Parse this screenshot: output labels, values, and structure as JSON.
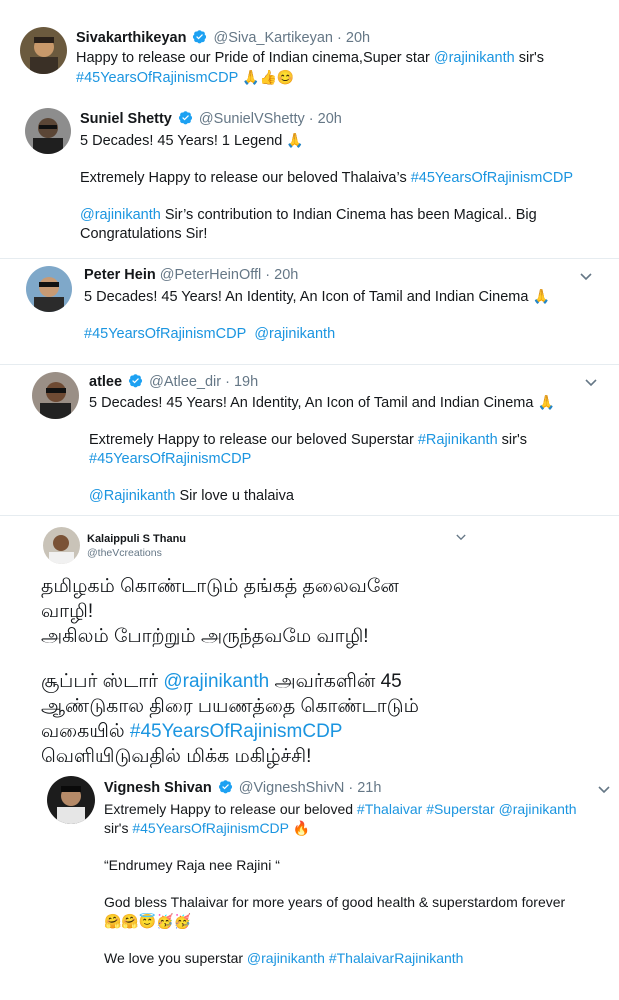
{
  "tweets": {
    "t1": {
      "name": "Sivakarthikeyan",
      "handle": "@Siva_Kartikeyan",
      "dot": "·",
      "time": "20h",
      "text_a": "Happy to release our Pride of Indian cinema,Super star ",
      "mention": "@rajinikanth",
      "text_b": " sir's",
      "hashtag": "#45YearsOfRajinismCDP",
      "emojis": "🙏👍😊"
    },
    "t2": {
      "name": "Suniel Shetty",
      "handle": "@SunielVShetty",
      "dot": "·",
      "time": "20h",
      "line1": "5 Decades! 45 Years! 1 Legend",
      "line1_emoji": "🙏",
      "line2_text": "Extremely Happy to release our beloved Thalaiva’s ",
      "line2_hashtag": "#45YearsOfRajinismCDP",
      "line3_mention": "@rajinikanth",
      "line3_text": " Sir’s contribution to Indian Cinema has been Magical.. Big Congratulations Sir!"
    },
    "t3": {
      "name": "Peter Hein",
      "handle": "@PeterHeinOffl",
      "dot": "·",
      "time": "20h",
      "line1": "5 Decades! 45 Years! An Identity, An Icon of Tamil and Indian Cinema",
      "line1_emoji": "🙏",
      "hashtag": "#45YearsOfRajinismCDP",
      "mention": "@rajinikanth"
    },
    "t4": {
      "name": "atlee",
      "handle": "@Atlee_dir",
      "dot": "·",
      "time": "19h",
      "line1": "5 Decades! 45 Years! An Identity, An Icon of Tamil and Indian Cinema",
      "line1_emoji": "🙏",
      "line2_text": "Extremely Happy to release our beloved Superstar ",
      "line2_hashtag": "#Rajinikanth",
      "line2_tail": " sir's",
      "line3_hashtag": "#45YearsOfRajinismCDP",
      "line4_mention": "@Rajinikanth",
      "line4_text": " Sir love u thalaiva"
    },
    "t5": {
      "name": "Kalaippuli S Thanu",
      "handle": "@theVcreations",
      "l1": "தமிழகம் கொண்டாடும் தங்கத் தலைவனே",
      "l2": "வாழி!",
      "l3": "அகிலம் போற்றும் அருந்தவமே வாழி!",
      "l4a": "சூப்பர் ஸ்டார் ",
      "l4_mention": "@rajinikanth",
      "l4b": " அவர்களின் 45",
      "l5": "ஆண்டுகால திரை பயணத்தை கொண்டாடும்",
      "l6a": "வகையில் ",
      "l6_hashtag": "#45YearsOfRajinismCDP",
      "l7": "வெளியிடுவதில் மிக்க மகிழ்ச்சி!"
    },
    "t6": {
      "name": "Vignesh Shivan",
      "handle": "@VigneshShivN",
      "dot": "·",
      "time": "21h",
      "l1_text": "Extremely Happy to release our beloved ",
      "l1_h1": "#Thalaivar",
      "l1_h2": "#Superstar",
      "l1_m": "@rajinikanth",
      "l2_text": "sir's ",
      "l2_h": "#45YearsOfRajinismCDP",
      "l2_emoji": "🔥",
      "l3": "“Endrumey Raja nee Rajini “",
      "l4": "God bless Thalaivar for more years of good health & superstardom forever",
      "l5_emojis": "🤗🤗😇🥳🥳",
      "l6_text": "We love you  superstar ",
      "l6_m": "@rajinikanth",
      "l6_h": "#ThalaivarRajinikanth"
    }
  },
  "colors": {
    "link": "#1b95e0",
    "verified": "#1da1f2",
    "muted": "#657786"
  }
}
